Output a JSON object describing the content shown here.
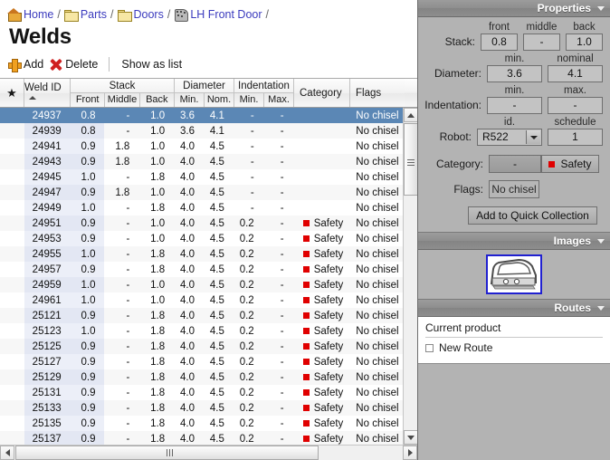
{
  "breadcrumb": {
    "items": [
      {
        "label": "Home",
        "icon": "home-icon"
      },
      {
        "label": "Parts",
        "icon": "folder-icon"
      },
      {
        "label": "Doors",
        "icon": "folder-icon"
      },
      {
        "label": "LH Front Door",
        "icon": "part-icon"
      }
    ],
    "separator": "/"
  },
  "page": {
    "title": "Welds"
  },
  "toolbar": {
    "add_label": "Add",
    "delete_label": "Delete",
    "show_as_list_label": "Show as list"
  },
  "grid": {
    "columns": {
      "star": "★",
      "weld_id": "Weld ID",
      "stack_group": "Stack",
      "stack_front": "Front",
      "stack_middle": "Middle",
      "stack_back": "Back",
      "diameter_group": "Diameter",
      "diameter_min": "Min.",
      "diameter_nom": "Nom.",
      "indentation_group": "Indentation",
      "indentation_min": "Min.",
      "indentation_max": "Max.",
      "category": "Category",
      "flags": "Flags"
    },
    "sorted_by": "Weld ID",
    "sort_direction": "ascending",
    "rows": [
      {
        "id": "24937",
        "front": "0.8",
        "middle": "-",
        "back": "1.0",
        "dmin": "3.6",
        "dnom": "4.1",
        "imin": "-",
        "imax": "-",
        "category": "",
        "cat_color": "",
        "flags": "No chisel",
        "selected": true
      },
      {
        "id": "24939",
        "front": "0.8",
        "middle": "-",
        "back": "1.0",
        "dmin": "3.6",
        "dnom": "4.1",
        "imin": "-",
        "imax": "-",
        "category": "",
        "cat_color": "",
        "flags": "No chisel",
        "selected": false
      },
      {
        "id": "24941",
        "front": "0.9",
        "middle": "1.8",
        "back": "1.0",
        "dmin": "4.0",
        "dnom": "4.5",
        "imin": "-",
        "imax": "-",
        "category": "",
        "cat_color": "",
        "flags": "No chisel",
        "selected": false
      },
      {
        "id": "24943",
        "front": "0.9",
        "middle": "1.8",
        "back": "1.0",
        "dmin": "4.0",
        "dnom": "4.5",
        "imin": "-",
        "imax": "-",
        "category": "",
        "cat_color": "",
        "flags": "No chisel",
        "selected": false
      },
      {
        "id": "24945",
        "front": "1.0",
        "middle": "-",
        "back": "1.8",
        "dmin": "4.0",
        "dnom": "4.5",
        "imin": "-",
        "imax": "-",
        "category": "",
        "cat_color": "",
        "flags": "No chisel",
        "selected": false
      },
      {
        "id": "24947",
        "front": "0.9",
        "middle": "1.8",
        "back": "1.0",
        "dmin": "4.0",
        "dnom": "4.5",
        "imin": "-",
        "imax": "-",
        "category": "",
        "cat_color": "",
        "flags": "No chisel",
        "selected": false
      },
      {
        "id": "24949",
        "front": "1.0",
        "middle": "-",
        "back": "1.8",
        "dmin": "4.0",
        "dnom": "4.5",
        "imin": "-",
        "imax": "-",
        "category": "",
        "cat_color": "",
        "flags": "No chisel",
        "selected": false
      },
      {
        "id": "24951",
        "front": "0.9",
        "middle": "-",
        "back": "1.0",
        "dmin": "4.0",
        "dnom": "4.5",
        "imin": "0.2",
        "imax": "-",
        "category": "Safety",
        "cat_color": "#e00000",
        "flags": "No chisel",
        "selected": false
      },
      {
        "id": "24953",
        "front": "0.9",
        "middle": "-",
        "back": "1.0",
        "dmin": "4.0",
        "dnom": "4.5",
        "imin": "0.2",
        "imax": "-",
        "category": "Safety",
        "cat_color": "#e00000",
        "flags": "No chisel",
        "selected": false
      },
      {
        "id": "24955",
        "front": "1.0",
        "middle": "-",
        "back": "1.8",
        "dmin": "4.0",
        "dnom": "4.5",
        "imin": "0.2",
        "imax": "-",
        "category": "Safety",
        "cat_color": "#e00000",
        "flags": "No chisel",
        "selected": false
      },
      {
        "id": "24957",
        "front": "0.9",
        "middle": "-",
        "back": "1.8",
        "dmin": "4.0",
        "dnom": "4.5",
        "imin": "0.2",
        "imax": "-",
        "category": "Safety",
        "cat_color": "#e00000",
        "flags": "No chisel",
        "selected": false
      },
      {
        "id": "24959",
        "front": "1.0",
        "middle": "-",
        "back": "1.0",
        "dmin": "4.0",
        "dnom": "4.5",
        "imin": "0.2",
        "imax": "-",
        "category": "Safety",
        "cat_color": "#e00000",
        "flags": "No chisel",
        "selected": false
      },
      {
        "id": "24961",
        "front": "1.0",
        "middle": "-",
        "back": "1.0",
        "dmin": "4.0",
        "dnom": "4.5",
        "imin": "0.2",
        "imax": "-",
        "category": "Safety",
        "cat_color": "#e00000",
        "flags": "No chisel",
        "selected": false
      },
      {
        "id": "25121",
        "front": "0.9",
        "middle": "-",
        "back": "1.8",
        "dmin": "4.0",
        "dnom": "4.5",
        "imin": "0.2",
        "imax": "-",
        "category": "Safety",
        "cat_color": "#e00000",
        "flags": "No chisel",
        "selected": false
      },
      {
        "id": "25123",
        "front": "1.0",
        "middle": "-",
        "back": "1.8",
        "dmin": "4.0",
        "dnom": "4.5",
        "imin": "0.2",
        "imax": "-",
        "category": "Safety",
        "cat_color": "#e00000",
        "flags": "No chisel",
        "selected": false
      },
      {
        "id": "25125",
        "front": "0.9",
        "middle": "-",
        "back": "1.8",
        "dmin": "4.0",
        "dnom": "4.5",
        "imin": "0.2",
        "imax": "-",
        "category": "Safety",
        "cat_color": "#e00000",
        "flags": "No chisel",
        "selected": false
      },
      {
        "id": "25127",
        "front": "0.9",
        "middle": "-",
        "back": "1.8",
        "dmin": "4.0",
        "dnom": "4.5",
        "imin": "0.2",
        "imax": "-",
        "category": "Safety",
        "cat_color": "#e00000",
        "flags": "No chisel",
        "selected": false
      },
      {
        "id": "25129",
        "front": "0.9",
        "middle": "-",
        "back": "1.8",
        "dmin": "4.0",
        "dnom": "4.5",
        "imin": "0.2",
        "imax": "-",
        "category": "Safety",
        "cat_color": "#e00000",
        "flags": "No chisel",
        "selected": false
      },
      {
        "id": "25131",
        "front": "0.9",
        "middle": "-",
        "back": "1.8",
        "dmin": "4.0",
        "dnom": "4.5",
        "imin": "0.2",
        "imax": "-",
        "category": "Safety",
        "cat_color": "#e00000",
        "flags": "No chisel",
        "selected": false
      },
      {
        "id": "25133",
        "front": "0.9",
        "middle": "-",
        "back": "1.8",
        "dmin": "4.0",
        "dnom": "4.5",
        "imin": "0.2",
        "imax": "-",
        "category": "Safety",
        "cat_color": "#e00000",
        "flags": "No chisel",
        "selected": false
      },
      {
        "id": "25135",
        "front": "0.9",
        "middle": "-",
        "back": "1.8",
        "dmin": "4.0",
        "dnom": "4.5",
        "imin": "0.2",
        "imax": "-",
        "category": "Safety",
        "cat_color": "#e00000",
        "flags": "No chisel",
        "selected": false
      },
      {
        "id": "25137",
        "front": "0.9",
        "middle": "-",
        "back": "1.8",
        "dmin": "4.0",
        "dnom": "4.5",
        "imin": "0.2",
        "imax": "-",
        "category": "Safety",
        "cat_color": "#e00000",
        "flags": "No chisel",
        "selected": false
      }
    ]
  },
  "properties": {
    "title": "Properties",
    "stack": {
      "label": "Stack:",
      "front_cap": "front",
      "front_value": "0.8",
      "middle_cap": "middle",
      "middle_value": "-",
      "back_cap": "back",
      "back_value": "1.0"
    },
    "diameter": {
      "label": "Diameter:",
      "min_cap": "min.",
      "min_value": "3.6",
      "nominal_cap": "nominal",
      "nominal_value": "4.1"
    },
    "indentation": {
      "label": "Indentation:",
      "min_cap": "min.",
      "min_value": "-",
      "max_cap": "max.",
      "max_value": "-"
    },
    "robot": {
      "label": "Robot:",
      "id_cap": "id.",
      "id_value": "R522",
      "schedule_cap": "schedule",
      "schedule_value": "1"
    },
    "category": {
      "label": "Category:",
      "none_value": "-",
      "safety_value": "Safety",
      "safety_color": "#e00000"
    },
    "flags": {
      "label": "Flags:",
      "value": "No chisel"
    },
    "quick_collection_label": "Add to Quick Collection"
  },
  "images": {
    "title": "Images",
    "selected_thumb": "lh-front-door-thumbnail"
  },
  "routes": {
    "title": "Routes",
    "current_product_label": "Current product",
    "new_route_label": "New Route"
  }
}
